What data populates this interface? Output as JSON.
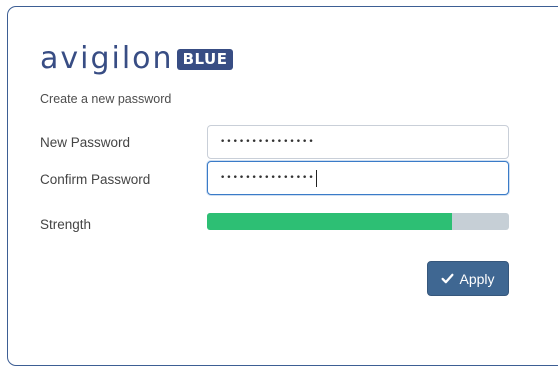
{
  "brand": {
    "logo_text": "avigilon",
    "badge": "BLUE",
    "color": "#384d84"
  },
  "form": {
    "subtitle": "Create a new password",
    "new_password": {
      "label": "New Password",
      "value": "•••••••••••••••"
    },
    "confirm_password": {
      "label": "Confirm Password",
      "value": "•••••••••••••••"
    },
    "strength": {
      "label": "Strength",
      "level": 0.81,
      "fill_color": "#2dbf74",
      "track_color": "#c6cfd6"
    }
  },
  "actions": {
    "apply_label": "Apply",
    "apply_icon": "check-icon"
  }
}
